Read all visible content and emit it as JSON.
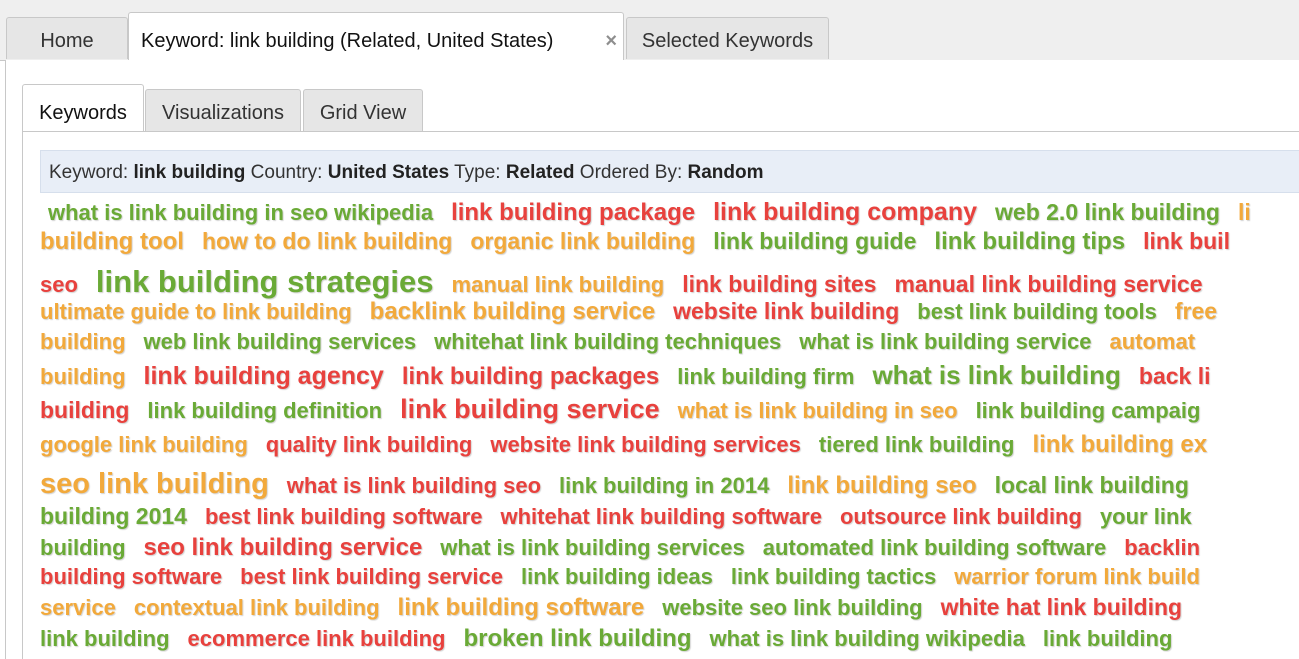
{
  "top_tabs": [
    {
      "label": "Home",
      "active": false
    },
    {
      "label": "Keyword: link building (Related, United States)",
      "active": true,
      "close": "×"
    },
    {
      "label": "Selected Keywords",
      "active": false
    }
  ],
  "sub_tabs": [
    {
      "label": "Keywords",
      "active": true
    },
    {
      "label": "Visualizations",
      "active": false
    },
    {
      "label": "Grid View",
      "active": false
    }
  ],
  "info": {
    "keyword_label": "Keyword:",
    "keyword": "link building",
    "country_label": "Country:",
    "country": "United States",
    "type_label": "Type:",
    "type": "Related",
    "ordered_label": "Ordered By:",
    "ordered": "Random"
  },
  "colors": {
    "green": "#6aaa36",
    "red": "#e8413d",
    "orange": "#f2a93b"
  },
  "cloud_rows": [
    [
      {
        "t": "what is link building in seo wikipedia",
        "c": "green",
        "s": 22
      },
      {
        "t": "link building package",
        "c": "red",
        "s": 24
      },
      {
        "t": "link building company",
        "c": "red",
        "s": 25
      },
      {
        "t": "web 2.0 link building",
        "c": "green",
        "s": 23
      },
      {
        "t": "li",
        "c": "orange",
        "s": 23
      }
    ],
    [
      {
        "t": "building tool",
        "c": "orange",
        "s": 24
      },
      {
        "t": "how to do link building",
        "c": "orange",
        "s": 23
      },
      {
        "t": "organic link building",
        "c": "orange",
        "s": 23
      },
      {
        "t": "link building guide",
        "c": "green",
        "s": 23
      },
      {
        "t": "link building tips",
        "c": "green",
        "s": 24
      },
      {
        "t": "link buil",
        "c": "red",
        "s": 23
      }
    ],
    [
      {
        "t": "seo",
        "c": "red",
        "s": 22
      },
      {
        "t": "link building strategies",
        "c": "green",
        "s": 31
      },
      {
        "t": "manual link building",
        "c": "orange",
        "s": 22
      },
      {
        "t": "link building sites",
        "c": "red",
        "s": 23
      },
      {
        "t": "manual link building service",
        "c": "red",
        "s": 23
      }
    ],
    [
      {
        "t": "ultimate guide to link building",
        "c": "orange",
        "s": 22
      },
      {
        "t": "backlink building service",
        "c": "orange",
        "s": 24
      },
      {
        "t": "website link building",
        "c": "red",
        "s": 23
      },
      {
        "t": "best link building tools",
        "c": "green",
        "s": 22
      },
      {
        "t": "free",
        "c": "orange",
        "s": 23
      }
    ],
    [
      {
        "t": "building",
        "c": "orange",
        "s": 22
      },
      {
        "t": "web link building services",
        "c": "green",
        "s": 22
      },
      {
        "t": "whitehat link building techniques",
        "c": "green",
        "s": 22
      },
      {
        "t": "what is link building service",
        "c": "green",
        "s": 22
      },
      {
        "t": "automat",
        "c": "orange",
        "s": 22
      }
    ],
    [
      {
        "t": "building",
        "c": "orange",
        "s": 22
      },
      {
        "t": "link building agency",
        "c": "red",
        "s": 25
      },
      {
        "t": "link building packages",
        "c": "red",
        "s": 24
      },
      {
        "t": "link building firm",
        "c": "green",
        "s": 22
      },
      {
        "t": "what is link building",
        "c": "green",
        "s": 26
      },
      {
        "t": "back li",
        "c": "red",
        "s": 23
      }
    ],
    [
      {
        "t": "building",
        "c": "red",
        "s": 23
      },
      {
        "t": "link building definition",
        "c": "green",
        "s": 22
      },
      {
        "t": "link building service",
        "c": "red",
        "s": 27
      },
      {
        "t": "what is link building in seo",
        "c": "orange",
        "s": 22
      },
      {
        "t": "link building campaig",
        "c": "green",
        "s": 22
      }
    ],
    [
      {
        "t": "google link building",
        "c": "orange",
        "s": 22
      },
      {
        "t": "quality link building",
        "c": "red",
        "s": 22
      },
      {
        "t": "website link building services",
        "c": "red",
        "s": 22
      },
      {
        "t": "tiered link building",
        "c": "green",
        "s": 22
      },
      {
        "t": "link building ex",
        "c": "orange",
        "s": 24
      }
    ],
    [
      {
        "t": "seo link building",
        "c": "orange",
        "s": 29
      },
      {
        "t": "what is link building seo",
        "c": "red",
        "s": 22
      },
      {
        "t": "link building in 2014",
        "c": "green",
        "s": 22
      },
      {
        "t": "link building seo",
        "c": "orange",
        "s": 24
      },
      {
        "t": "local link building",
        "c": "green",
        "s": 23
      }
    ],
    [
      {
        "t": "building 2014",
        "c": "green",
        "s": 23
      },
      {
        "t": "best link building software",
        "c": "red",
        "s": 22
      },
      {
        "t": "whitehat link building software",
        "c": "red",
        "s": 22
      },
      {
        "t": "outsource link building",
        "c": "red",
        "s": 22
      },
      {
        "t": "your link",
        "c": "green",
        "s": 22
      }
    ],
    [
      {
        "t": "building",
        "c": "green",
        "s": 22
      },
      {
        "t": "seo link building service",
        "c": "red",
        "s": 24
      },
      {
        "t": "what is link building services",
        "c": "green",
        "s": 22
      },
      {
        "t": "automated link building software",
        "c": "green",
        "s": 22
      },
      {
        "t": "backlin",
        "c": "red",
        "s": 22
      }
    ],
    [
      {
        "t": "building software",
        "c": "red",
        "s": 22
      },
      {
        "t": "best link building service",
        "c": "red",
        "s": 22
      },
      {
        "t": "link building ideas",
        "c": "green",
        "s": 22
      },
      {
        "t": "link building tactics",
        "c": "green",
        "s": 22
      },
      {
        "t": "warrior forum link build",
        "c": "orange",
        "s": 22
      }
    ],
    [
      {
        "t": "service",
        "c": "orange",
        "s": 22
      },
      {
        "t": "contextual link building",
        "c": "orange",
        "s": 22
      },
      {
        "t": "link building software",
        "c": "orange",
        "s": 24
      },
      {
        "t": "website seo link building",
        "c": "green",
        "s": 22
      },
      {
        "t": "white hat link building",
        "c": "red",
        "s": 23
      }
    ],
    [
      {
        "t": "link building",
        "c": "green",
        "s": 22
      },
      {
        "t": "ecommerce link building",
        "c": "red",
        "s": 22
      },
      {
        "t": "broken link building",
        "c": "green",
        "s": 24
      },
      {
        "t": "what is link building wikipedia",
        "c": "green",
        "s": 22
      },
      {
        "t": "link building",
        "c": "green",
        "s": 22
      }
    ]
  ]
}
